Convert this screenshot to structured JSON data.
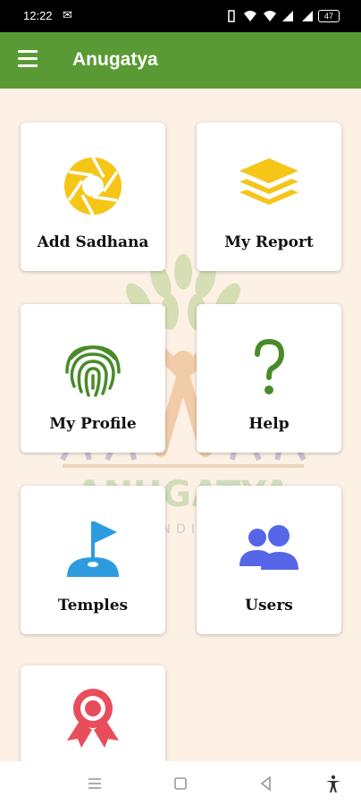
{
  "status_bar": {
    "time": "12:22",
    "battery": "47",
    "icons": [
      "gmail-icon",
      "vibrate-icon",
      "wifi-icon",
      "signal-icon",
      "signal-icon",
      "battery-icon"
    ]
  },
  "app_bar": {
    "title": "Anugatya",
    "menu_icon": "hamburger-menu-icon",
    "color": "#5a9a34"
  },
  "watermark": {
    "text": "ANUGATYA",
    "subtitle": "INDIA"
  },
  "cards": [
    {
      "label": "Add Sadhana",
      "icon": "camera-shutter-icon",
      "color": "#f5c518"
    },
    {
      "label": "My Report",
      "icon": "layers-stack-icon",
      "color": "#f5c518"
    },
    {
      "label": "My Profile",
      "icon": "fingerprint-icon",
      "color": "#4a8a2a"
    },
    {
      "label": "Help",
      "icon": "question-mark-icon",
      "color": "#4a8a2a"
    },
    {
      "label": "Temples",
      "icon": "flag-pin-icon",
      "color": "#2d9be0"
    },
    {
      "label": "Users",
      "icon": "users-group-icon",
      "color": "#5566e8"
    },
    {
      "label": "",
      "icon": "award-ribbon-icon",
      "color": "#e84d5b"
    }
  ],
  "nav_bar": {
    "icons": [
      "recents-icon",
      "home-icon",
      "back-icon",
      "accessibility-icon"
    ]
  }
}
